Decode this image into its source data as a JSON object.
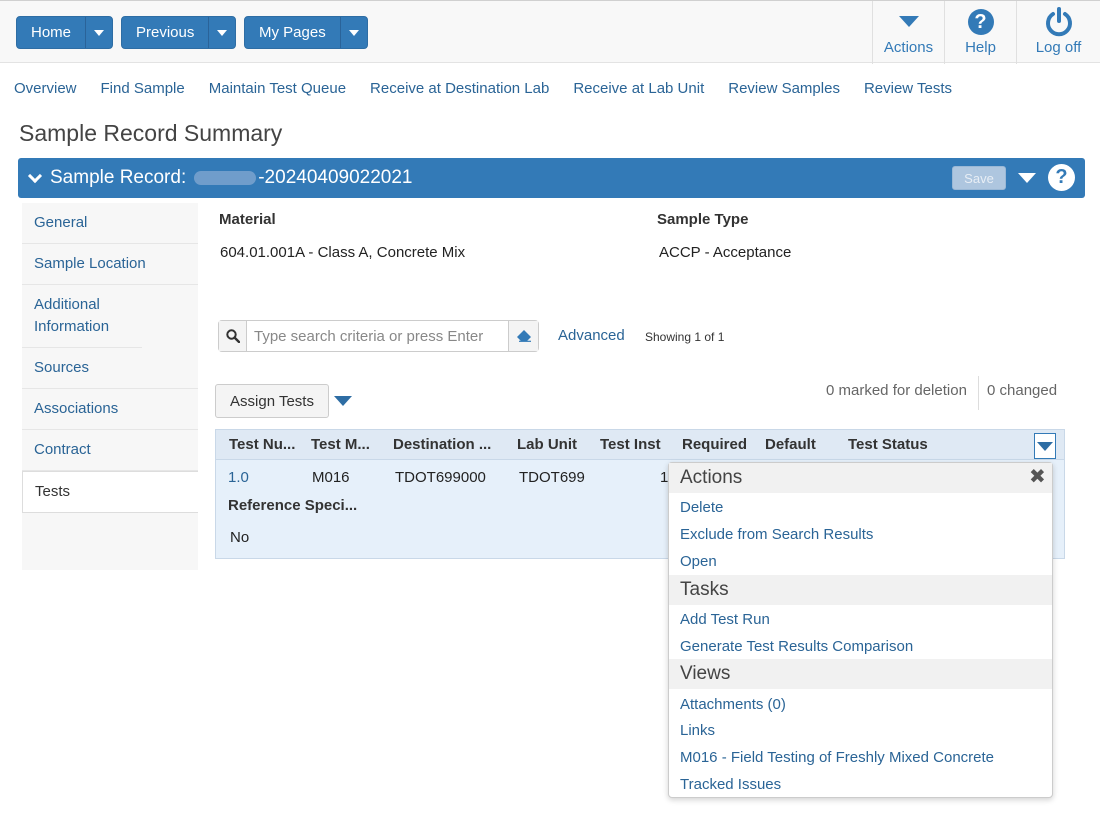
{
  "topbar": {
    "home_label": "Home",
    "previous_label": "Previous",
    "mypages_label": "My Pages",
    "actions_label": "Actions",
    "help_label": "Help",
    "logoff_label": "Log off"
  },
  "nav": {
    "links": [
      "Overview",
      "Find Sample",
      "Maintain Test Queue",
      "Receive at Destination Lab",
      "Receive at Lab Unit",
      "Review Samples",
      "Review Tests"
    ]
  },
  "page_title": "Sample Record Summary",
  "record": {
    "title_prefix": "Sample Record:",
    "title_suffix": "-20240409022021",
    "save_label": "Save"
  },
  "sidenav": {
    "items": [
      "General",
      "Sample Location",
      "Additional Information",
      "Sources",
      "Associations",
      "Contract",
      "Tests"
    ],
    "active": "Tests"
  },
  "details": {
    "material_label": "Material",
    "material_value": "604.01.001A - Class A, Concrete Mix",
    "sample_type_label": "Sample Type",
    "sample_type_value": "ACCP - Acceptance"
  },
  "search": {
    "placeholder": "Type search criteria or press Enter",
    "advanced_label": "Advanced",
    "showing_text": "Showing 1 of 1"
  },
  "toolbar": {
    "assign_label": "Assign Tests",
    "deletion_text": "0 marked for deletion",
    "changed_text": "0 changed"
  },
  "grid": {
    "headers": [
      "Test Nu...",
      "Test M...",
      "Destination ...",
      "Lab Unit",
      "Test Inst",
      "Required",
      "Default",
      "Test Status"
    ],
    "row": {
      "test_number": "1.0",
      "test_method": "M016",
      "destination": "TDOT699000",
      "lab_unit": "TDOT699",
      "test_inst": "1"
    },
    "ref_spec_label": "Reference Speci...",
    "ref_spec_value": "No"
  },
  "menu": {
    "sections": {
      "actions": "Actions",
      "tasks": "Tasks",
      "views": "Views"
    },
    "actions": [
      "Delete",
      "Exclude from Search Results",
      "Open"
    ],
    "tasks": [
      "Add Test Run",
      "Generate Test Results Comparison"
    ],
    "views": [
      "Attachments (0)",
      "Links",
      "M016 - Field Testing of Freshly Mixed Concrete",
      "Tracked Issues"
    ]
  }
}
